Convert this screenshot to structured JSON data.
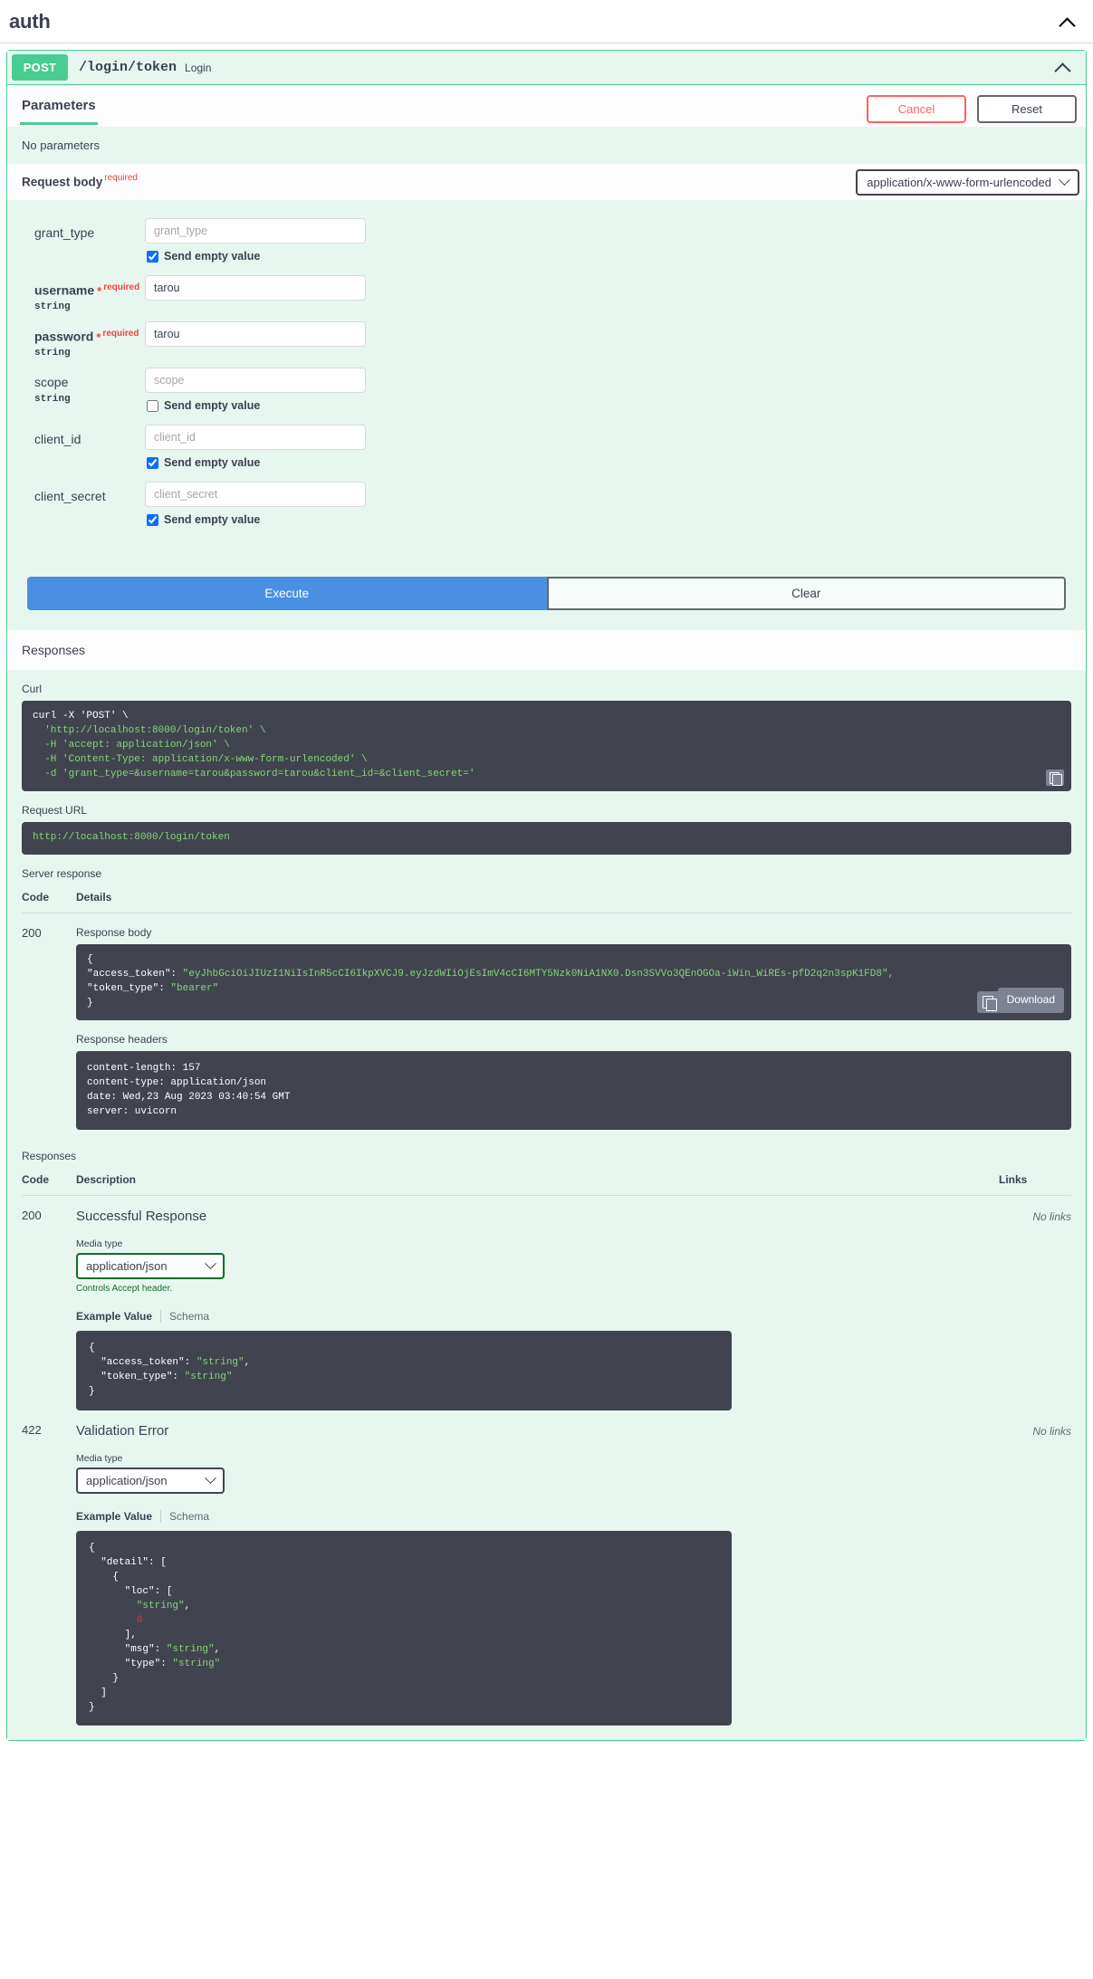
{
  "tag": {
    "title": "auth",
    "collapse_icon": "chevron-up-icon"
  },
  "operation": {
    "method": "POST",
    "path": "/login/token",
    "summary": "Login",
    "collapse_icon": "chevron-up-icon"
  },
  "parameters_tab": {
    "label": "Parameters",
    "cancel_label": "Cancel",
    "reset_label": "Reset",
    "no_parameters": "No parameters"
  },
  "request_body": {
    "label": "Request body",
    "required_badge": "required",
    "content_type": "application/x-www-form-urlencoded",
    "fields": [
      {
        "name": "grant_type",
        "type": "",
        "required": false,
        "value": "",
        "placeholder": "grant_type",
        "send_empty_label": "Send empty value",
        "send_empty_checked": true,
        "has_send_empty": true
      },
      {
        "name": "username",
        "type": "string",
        "required": true,
        "required_badge": "required",
        "value": "tarou",
        "placeholder": "",
        "has_send_empty": false
      },
      {
        "name": "password",
        "type": "string",
        "required": true,
        "required_badge": "required",
        "value": "tarou",
        "placeholder": "",
        "has_send_empty": false
      },
      {
        "name": "scope",
        "type": "string",
        "required": false,
        "value": "",
        "placeholder": "scope",
        "send_empty_label": "Send empty value",
        "send_empty_checked": false,
        "has_send_empty": true
      },
      {
        "name": "client_id",
        "type": "",
        "required": false,
        "value": "",
        "placeholder": "client_id",
        "send_empty_label": "Send empty value",
        "send_empty_checked": true,
        "has_send_empty": true
      },
      {
        "name": "client_secret",
        "type": "",
        "required": false,
        "value": "",
        "placeholder": "client_secret",
        "send_empty_label": "Send empty value",
        "send_empty_checked": true,
        "has_send_empty": true
      }
    ]
  },
  "actions": {
    "execute_label": "Execute",
    "clear_label": "Clear"
  },
  "responses_heading": "Responses",
  "live_response": {
    "curl_label": "Curl",
    "curl_lines": [
      "curl -X 'POST' \\",
      "  'http://localhost:8000/login/token' \\",
      "  -H 'accept: application/json' \\",
      "  -H 'Content-Type: application/x-www-form-urlencoded' \\",
      "  -d 'grant_type=&username=tarou&password=tarou&client_id=&client_secret='"
    ],
    "request_url_label": "Request URL",
    "request_url": "http://localhost:8000/login/token",
    "server_response_label": "Server response",
    "col_code": "Code",
    "col_details": "Details",
    "code": "200",
    "response_body_label": "Response body",
    "response_body_open": "{",
    "response_body_line1_key": "\"access_token\": ",
    "response_body_line1_val": "\"eyJhbGciOiJIUzI1NiIsInR5cCI6IkpXVCJ9.eyJzdWIiOjEsImV4cCI6MTY5Nzk0NiA1NX0.Dsn3SVVo3QEnOGOa-iWin_WiREs-pfD2q2n3spK1FD8\",",
    "response_body_line2_key": "\"token_type\": ",
    "response_body_line2_val": "\"bearer\"",
    "response_body_close": "}",
    "download_label": "Download",
    "copy_icon": "copy-icon",
    "download_icon": "download-icon",
    "response_headers_label": "Response headers",
    "response_headers": [
      "content-length: 157",
      "content-type: application/json",
      "date: Wed,23 Aug 2023 03:40:54 GMT",
      "server: uvicorn"
    ]
  },
  "responses_table": {
    "title": "Responses",
    "col_code": "Code",
    "col_description": "Description",
    "col_links": "Links",
    "rows": [
      {
        "code": "200",
        "description": "Successful Response",
        "links": "No links",
        "media_type_label": "Media type",
        "media_type": "application/json",
        "controls_accept": "Controls Accept header.",
        "tab_example": "Example Value",
        "tab_schema": "Schema",
        "example_lines": [
          {
            "text": "{",
            "cls": "w"
          },
          {
            "text": "  \"access_token\": ",
            "cls": "w",
            "val": "\"string\"",
            "tail": ","
          },
          {
            "text": "  \"token_type\": ",
            "cls": "w",
            "val": "\"string\"",
            "tail": ""
          },
          {
            "text": "}",
            "cls": "w"
          }
        ]
      },
      {
        "code": "422",
        "description": "Validation Error",
        "links": "No links",
        "media_type_label": "Media type",
        "media_type": "application/json",
        "controls_accept": "",
        "tab_example": "Example Value",
        "tab_schema": "Schema",
        "example_lines": []
      }
    ]
  }
}
